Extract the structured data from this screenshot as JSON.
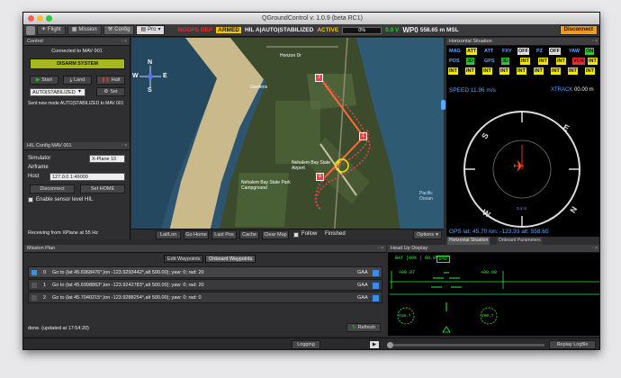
{
  "window": {
    "title": "QGroundControl v. 1.0.9 (beta RC1)"
  },
  "toolbar": {
    "tabs": [
      {
        "label": "Flight",
        "icon": "plane-icon"
      },
      {
        "label": "Mission",
        "icon": "map-icon"
      },
      {
        "label": "Config",
        "icon": "wrench-icon"
      }
    ],
    "vehicle_select": "Pro",
    "status": {
      "warning": "NOGPS DEP",
      "armed": "ARMED",
      "mode": "HIL A|AUTO|STABILIZED",
      "state": "ACTIVE",
      "battery_pct": "0%",
      "voltage": "0.0 V",
      "waypoint": "WP0",
      "altitude": "558.65 m MSL"
    },
    "disconnect_label": "Disconnect"
  },
  "control": {
    "title": "Control",
    "connected": "Connected to MAV 001",
    "disarm_label": "DISARM SYSTEM",
    "start_label": "Start",
    "land_label": "Land",
    "halt_label": "Halt",
    "mode_value": "AUTO|STABILIZED",
    "set_label": "Set",
    "message": "Sent new mode AUTO|STABILIZED to MAV 001"
  },
  "hil": {
    "title": "HIL Config MAV 001",
    "simulator_label": "Simulator",
    "simulator_value": "X-Plane 10",
    "airframe_label": "Airframe",
    "host_label": "Host",
    "host_value": "127.0.0.1:49000",
    "disconnect_label": "Disconnect",
    "sethome_label": "Set HOME",
    "sensor_label": "Enable sensor level HIL",
    "receiving": "Receiving from XPlane at 55 Hz"
  },
  "map": {
    "labels": [
      {
        "text": "Nehalem Bay State Park Campground",
        "id": "campground"
      },
      {
        "text": "Nehalem Bay State Airport",
        "id": "airport"
      },
      {
        "text": "Horizon Dr",
        "id": "road"
      },
      {
        "text": "Steve Bakes Constructions",
        "id": "steve"
      },
      {
        "text": "Gardens",
        "id": "gardens"
      },
      {
        "text": "Pacific Ocean",
        "id": "ocean"
      }
    ],
    "compass": [
      "N",
      "E",
      "S",
      "W"
    ],
    "waypoints": [
      "0",
      "1",
      "2"
    ],
    "buttons": [
      "Lat/Lon",
      "Go Home",
      "Last Pos",
      "Cache",
      "Clear Map"
    ],
    "follow_label": "Follow",
    "finished_label": "Finished",
    "options_label": "Options"
  },
  "horizontal_situation": {
    "title": "Horizontal Situation",
    "row1": [
      "MAG",
      "ATT",
      "ATT",
      "FXY",
      "OFF",
      "PZ",
      "OFF",
      "YAW",
      "ON"
    ],
    "row2": [
      "POS",
      "3D",
      "GPS",
      "3D",
      "INT",
      "INT",
      "INT",
      "VCN",
      "INT"
    ],
    "row3": [
      "INT",
      "INT",
      "INT",
      "INT",
      "INT",
      "INT",
      "INT",
      "INT",
      "INT"
    ],
    "speed": "SPEED 11.96 m/s",
    "xtrack": "XTRACK",
    "xtrack_value": "00.00 m",
    "compass": [
      "N",
      "E",
      "S",
      "W"
    ],
    "range_label": "3.4 m",
    "gps_line": "GPS lat: 45.70 lon: -123.93 alt: 558.65",
    "tabs": [
      "Horizontal Situation",
      "Onboard Parameters"
    ]
  },
  "mission": {
    "title": "Mission Plan",
    "tabs": [
      "Edit Waypoints",
      "Onboard Waypoints"
    ],
    "rows": [
      {
        "index": "0",
        "text": "Go to (lat 45.6968476°,lon -123.9293442°,alt 500.00); yaw: 0; rad: 20",
        "frame": "GAA"
      },
      {
        "index": "1",
        "text": "Go to (lat 45.6998863°,lon -123.9242783°,alt 500.00); yaw: 0; rad: 20",
        "frame": "GAA"
      },
      {
        "index": "2",
        "text": "Go to (lat 45.7040215°,lon -123.9288254°,alt 500.00); yaw: 0; rad: 0",
        "frame": "GAA"
      }
    ],
    "status": "done. (updated at 17:54:20)",
    "refresh_label": "Refresh"
  },
  "hud": {
    "title": "Head Up Display",
    "battery": "BAT [00% | 00.0V]",
    "heading": "242",
    "left_value": "+00.07",
    "right_value": "+00.00",
    "gauge_left": "S18.7",
    "gauge_right": "Z00.7"
  },
  "bottom": {
    "logging_label": "Logging",
    "replay_label": "Replay Logfile"
  },
  "colors": {
    "disarm_bg": "#a6b81e",
    "armed_bg": "#f2c500",
    "disconnect_bg": "#f29a1c",
    "hs_yellow": "#f2e600",
    "hs_green": "#2ec82e",
    "hud_green": "#2ef23a",
    "route": "#ff6a3a"
  }
}
